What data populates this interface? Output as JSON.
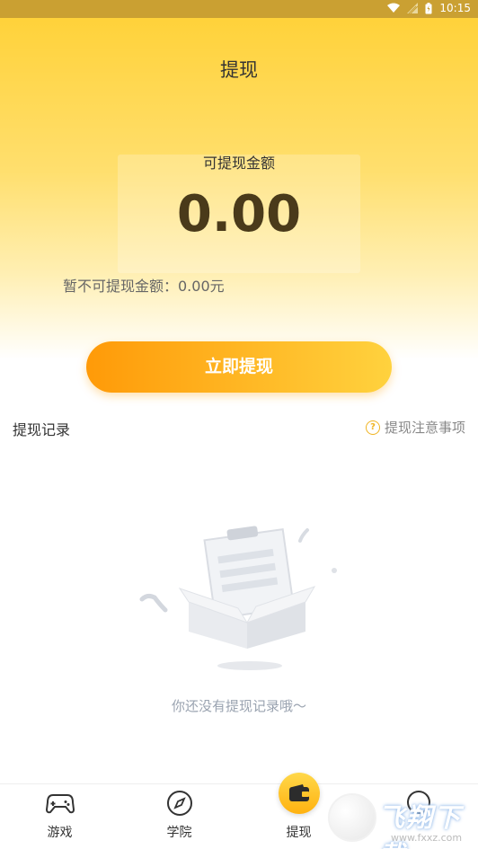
{
  "status_bar": {
    "time": "10:15"
  },
  "header": {
    "title": "提现"
  },
  "balance": {
    "label": "可提现金额",
    "amount": "0.00",
    "pending_text": "暂不可提现金额：0.00元"
  },
  "actions": {
    "withdraw_label": "立即提现"
  },
  "records": {
    "title": "提现记录",
    "notice_label": "提现注意事项",
    "empty_text": "你还没有提现记录哦～"
  },
  "tabbar": {
    "tabs": [
      {
        "label": "游戏",
        "icon": "gamepad-icon"
      },
      {
        "label": "学院",
        "icon": "compass-icon"
      },
      {
        "label": "提现",
        "icon": "wallet-icon",
        "active": true
      },
      {
        "label": "",
        "icon": "chat-icon"
      }
    ]
  },
  "watermark": {
    "text": "飞翔下载",
    "sub": "www.fxxz.com"
  },
  "colors": {
    "accent": "#ffb210",
    "button_start": "#ff9a08",
    "button_end": "#ffd23e"
  }
}
